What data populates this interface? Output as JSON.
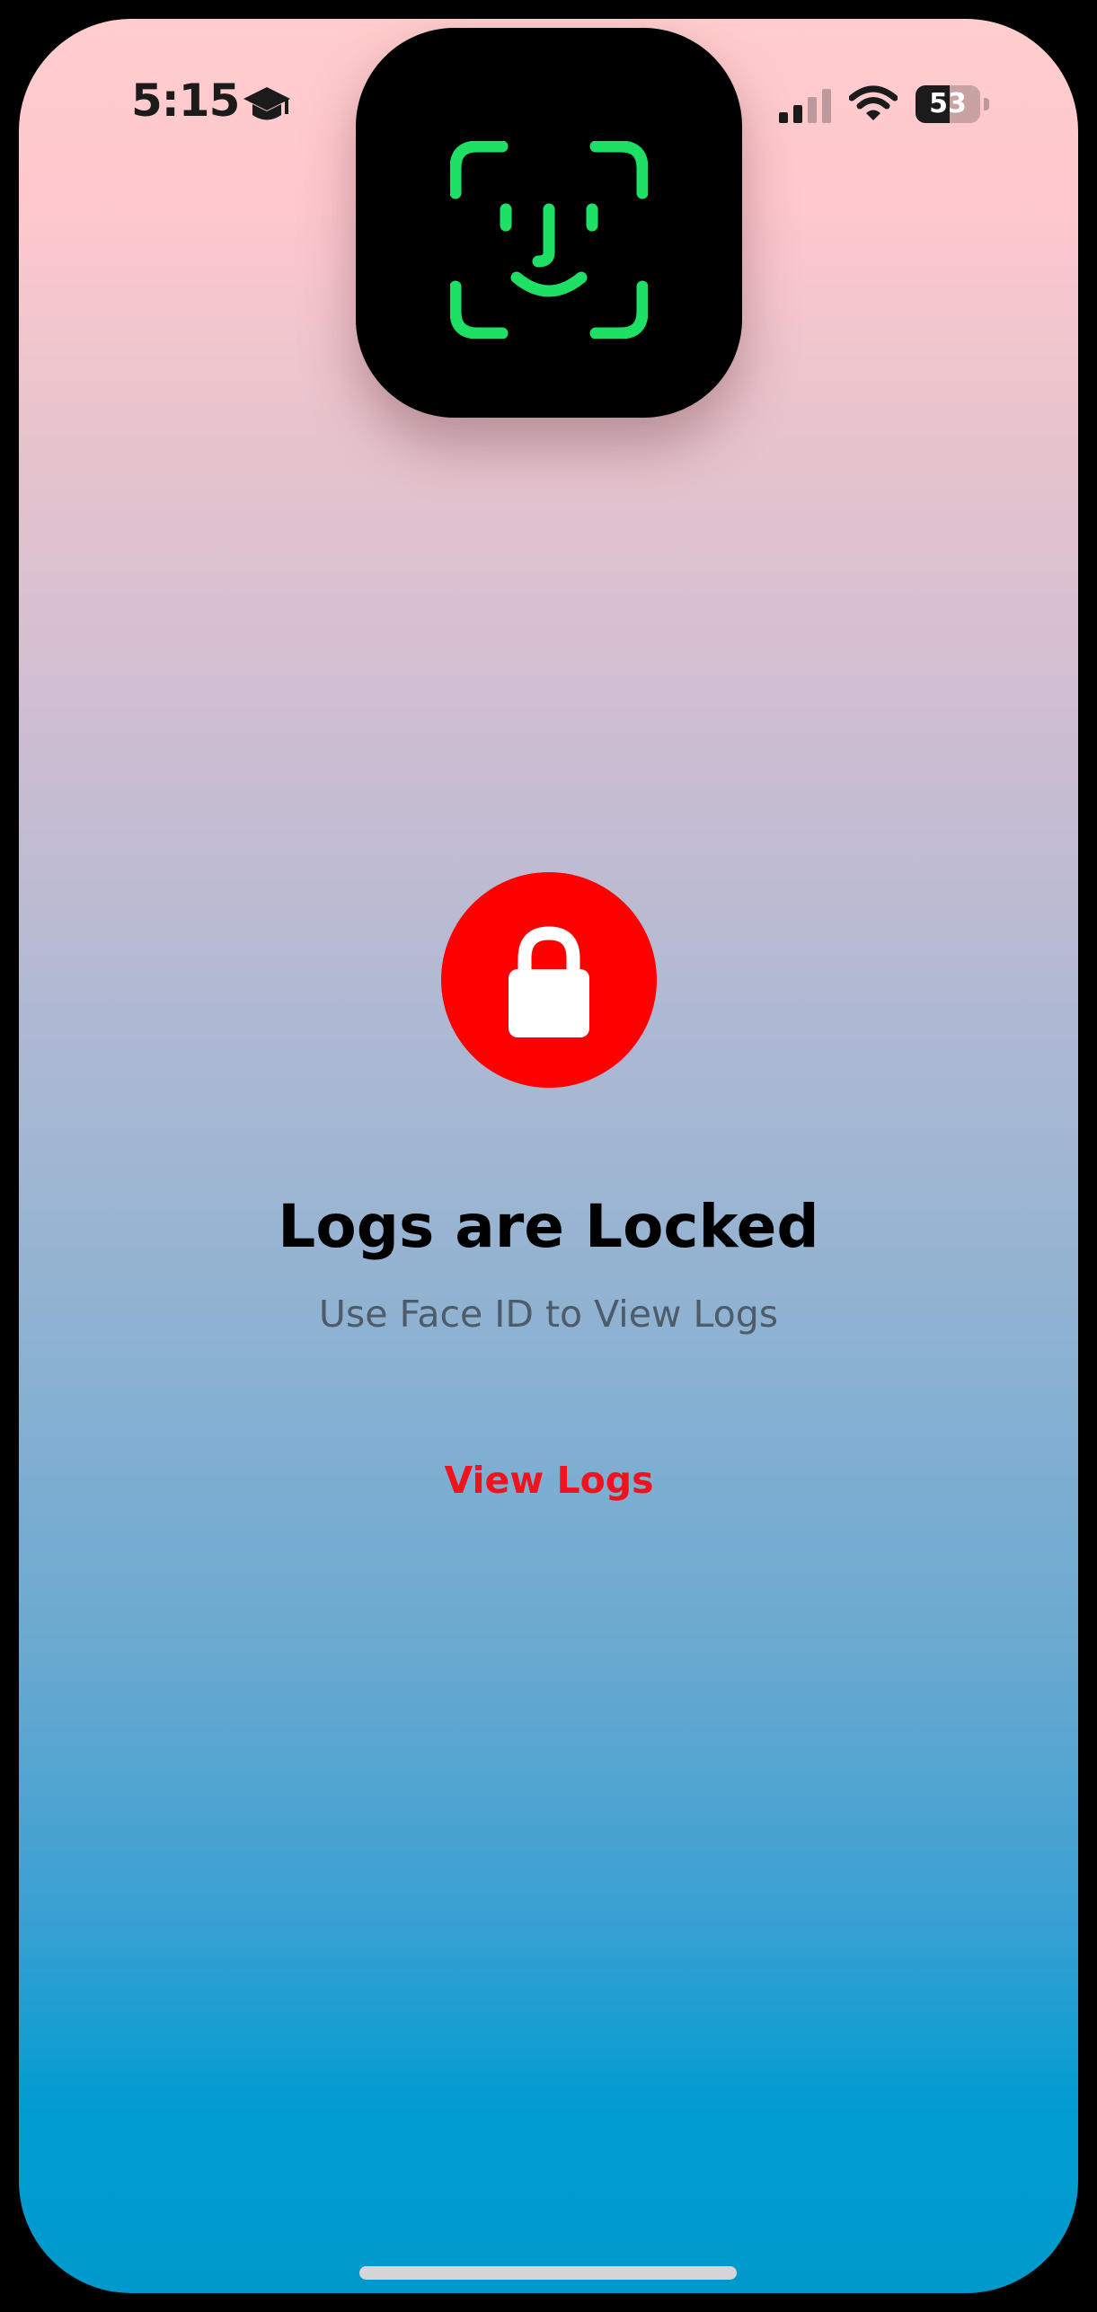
{
  "status_bar": {
    "time": "5:15",
    "activity_icon": "graduation-cap-icon",
    "signal_icon": "cellular-signal-icon",
    "wifi_icon": "wifi-icon",
    "battery_level": "53",
    "battery_fraction": 0.53
  },
  "overlay": {
    "icon": "face-id-icon",
    "icon_color": "#1ee065"
  },
  "lock": {
    "icon": "lock-icon",
    "badge_color": "#ff0000"
  },
  "main": {
    "title": "Logs are Locked",
    "subtitle": "Use Face ID to View Logs",
    "view_logs_label": "View Logs",
    "accent_color": "#f0131e"
  }
}
